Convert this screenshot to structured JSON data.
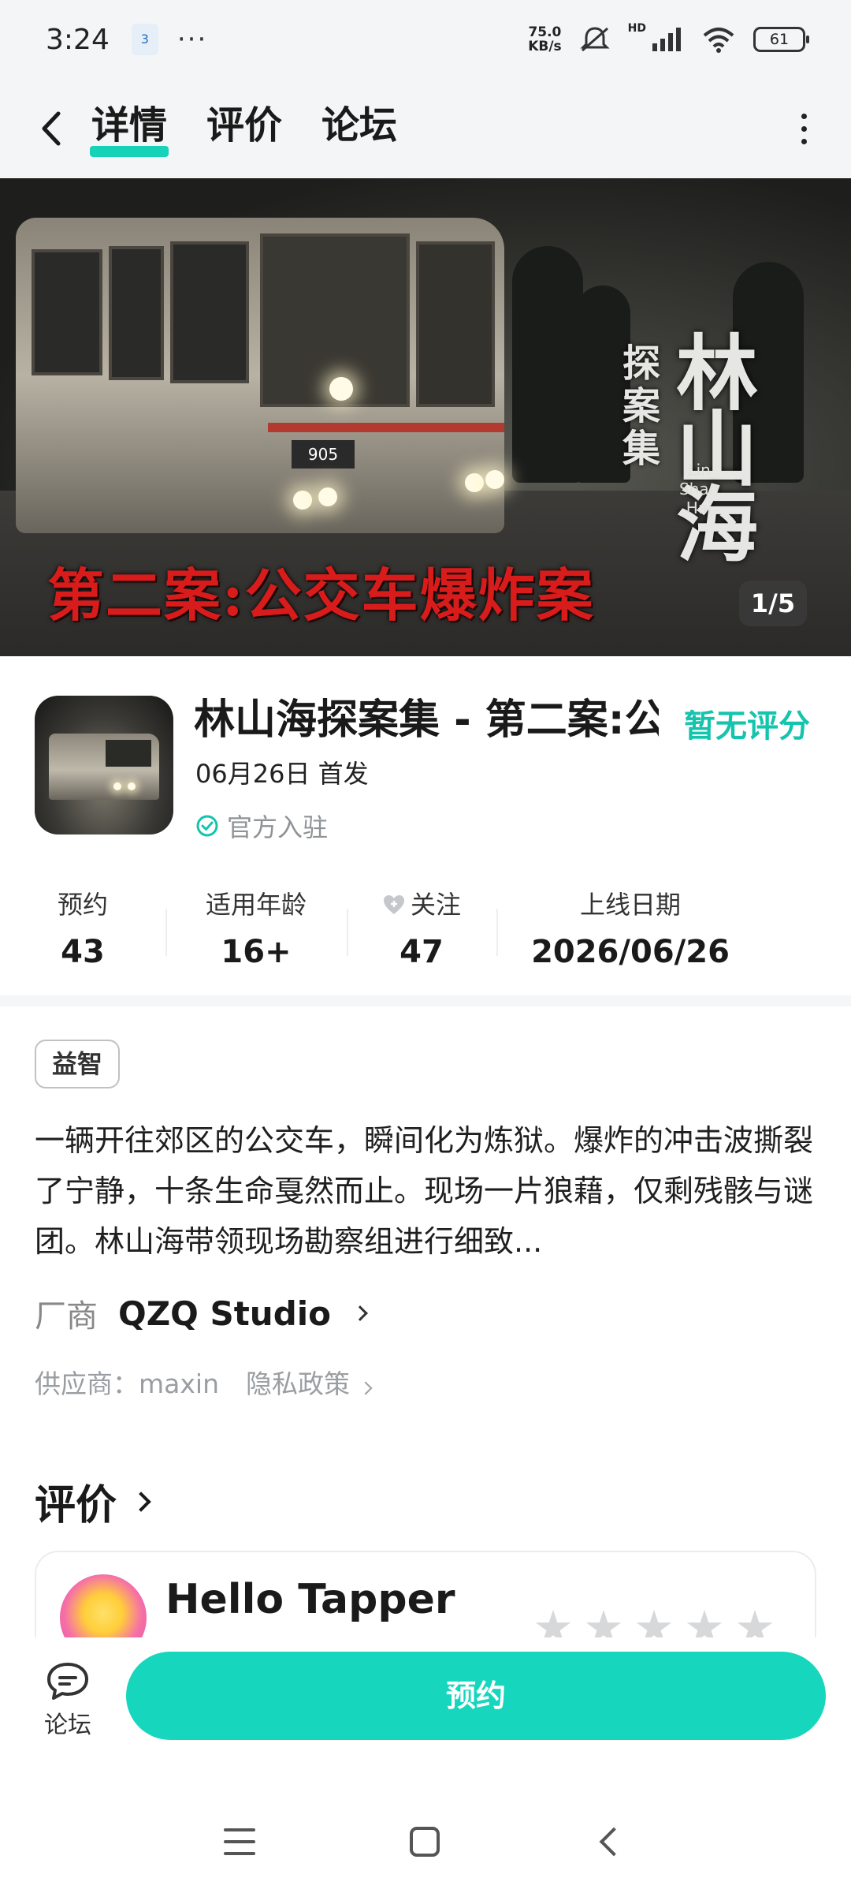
{
  "status_bar": {
    "time": "3:24",
    "notification_icon": "app-notification-icon",
    "more": "···",
    "net_speed_value": "75.0",
    "net_speed_unit": "KB/s",
    "signal_label": "HD",
    "battery": "61"
  },
  "header": {
    "tabs": [
      {
        "label": "详情",
        "active": true
      },
      {
        "label": "评价",
        "active": false
      },
      {
        "label": "论坛",
        "active": false
      }
    ]
  },
  "banner": {
    "title_overlay": "第二案:公交车爆炸案",
    "logo_main": "林山海",
    "logo_sub": "探案集",
    "logo_en_1": "Lin",
    "logo_en_2": "Shan",
    "logo_en_3": "Hai",
    "bus_number": "905",
    "page_indicator": "1/5"
  },
  "game": {
    "title": "林山海探案集 - 第二案:公交车爆炸案",
    "rating": "暂无评分",
    "release": "06月26日 首发",
    "official": "官方入驻"
  },
  "stats": [
    {
      "label": "预约",
      "value": "43"
    },
    {
      "label": "适用年龄",
      "value": "16+"
    },
    {
      "label": "关注",
      "value": "47"
    },
    {
      "label": "上线日期",
      "value": "2026/06/26"
    }
  ],
  "details": {
    "genre": "益智",
    "description": "一辆开往郊区的公交车，瞬间化为炼狱。爆炸的冲击波撕裂了宁静，十条生命戛然而止。现场一片狼藉，仅剩残骸与谜团。林山海带领现场勘察组进行细致...",
    "vendor_label": "厂商",
    "vendor_name": "QZQ Studio",
    "supplier": "供应商：maxin",
    "privacy": "隐私政策"
  },
  "reviews": {
    "title": "评价",
    "first_reviewer": "Hello Tapper",
    "stars_filled": 0,
    "stars_total": 5
  },
  "action_bar": {
    "forum_label": "论坛",
    "reserve_label": "预约"
  },
  "colors": {
    "accent": "#16d6bd",
    "rating": "#15c4ad",
    "banner_title": "#d81c1c"
  }
}
